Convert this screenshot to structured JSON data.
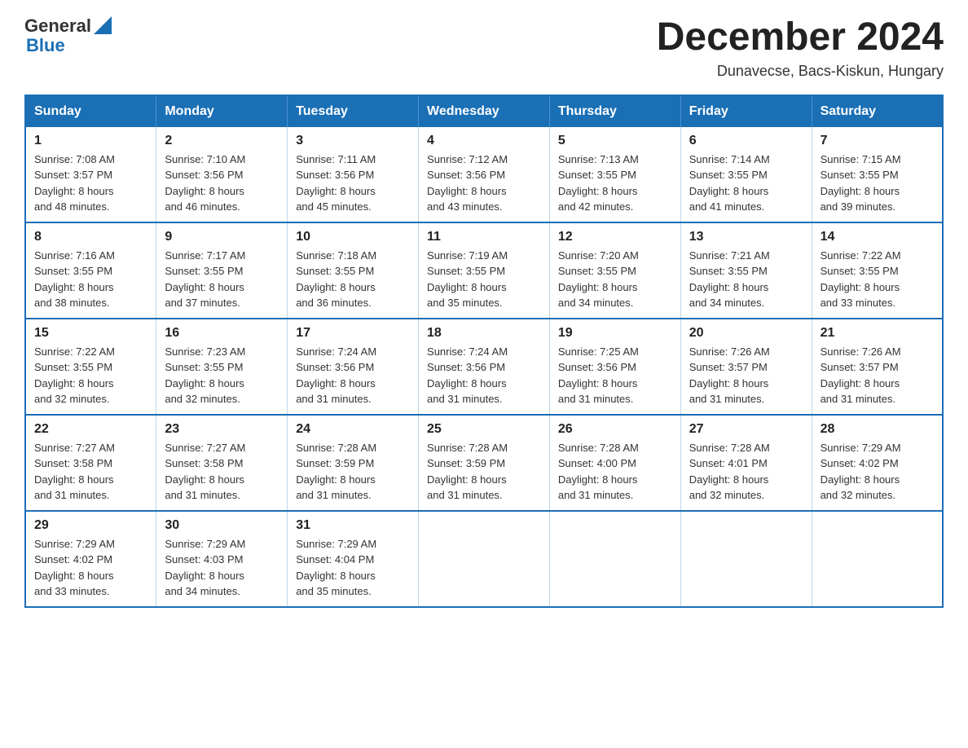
{
  "header": {
    "logo": {
      "text_general": "General",
      "text_blue": "Blue"
    },
    "title": "December 2024",
    "location": "Dunavecse, Bacs-Kiskun, Hungary"
  },
  "weekdays": [
    "Sunday",
    "Monday",
    "Tuesday",
    "Wednesday",
    "Thursday",
    "Friday",
    "Saturday"
  ],
  "weeks": [
    [
      {
        "day": "1",
        "sunrise": "7:08 AM",
        "sunset": "3:57 PM",
        "daylight": "8 hours and 48 minutes."
      },
      {
        "day": "2",
        "sunrise": "7:10 AM",
        "sunset": "3:56 PM",
        "daylight": "8 hours and 46 minutes."
      },
      {
        "day": "3",
        "sunrise": "7:11 AM",
        "sunset": "3:56 PM",
        "daylight": "8 hours and 45 minutes."
      },
      {
        "day": "4",
        "sunrise": "7:12 AM",
        "sunset": "3:56 PM",
        "daylight": "8 hours and 43 minutes."
      },
      {
        "day": "5",
        "sunrise": "7:13 AM",
        "sunset": "3:55 PM",
        "daylight": "8 hours and 42 minutes."
      },
      {
        "day": "6",
        "sunrise": "7:14 AM",
        "sunset": "3:55 PM",
        "daylight": "8 hours and 41 minutes."
      },
      {
        "day": "7",
        "sunrise": "7:15 AM",
        "sunset": "3:55 PM",
        "daylight": "8 hours and 39 minutes."
      }
    ],
    [
      {
        "day": "8",
        "sunrise": "7:16 AM",
        "sunset": "3:55 PM",
        "daylight": "8 hours and 38 minutes."
      },
      {
        "day": "9",
        "sunrise": "7:17 AM",
        "sunset": "3:55 PM",
        "daylight": "8 hours and 37 minutes."
      },
      {
        "day": "10",
        "sunrise": "7:18 AM",
        "sunset": "3:55 PM",
        "daylight": "8 hours and 36 minutes."
      },
      {
        "day": "11",
        "sunrise": "7:19 AM",
        "sunset": "3:55 PM",
        "daylight": "8 hours and 35 minutes."
      },
      {
        "day": "12",
        "sunrise": "7:20 AM",
        "sunset": "3:55 PM",
        "daylight": "8 hours and 34 minutes."
      },
      {
        "day": "13",
        "sunrise": "7:21 AM",
        "sunset": "3:55 PM",
        "daylight": "8 hours and 34 minutes."
      },
      {
        "day": "14",
        "sunrise": "7:22 AM",
        "sunset": "3:55 PM",
        "daylight": "8 hours and 33 minutes."
      }
    ],
    [
      {
        "day": "15",
        "sunrise": "7:22 AM",
        "sunset": "3:55 PM",
        "daylight": "8 hours and 32 minutes."
      },
      {
        "day": "16",
        "sunrise": "7:23 AM",
        "sunset": "3:55 PM",
        "daylight": "8 hours and 32 minutes."
      },
      {
        "day": "17",
        "sunrise": "7:24 AM",
        "sunset": "3:56 PM",
        "daylight": "8 hours and 31 minutes."
      },
      {
        "day": "18",
        "sunrise": "7:24 AM",
        "sunset": "3:56 PM",
        "daylight": "8 hours and 31 minutes."
      },
      {
        "day": "19",
        "sunrise": "7:25 AM",
        "sunset": "3:56 PM",
        "daylight": "8 hours and 31 minutes."
      },
      {
        "day": "20",
        "sunrise": "7:26 AM",
        "sunset": "3:57 PM",
        "daylight": "8 hours and 31 minutes."
      },
      {
        "day": "21",
        "sunrise": "7:26 AM",
        "sunset": "3:57 PM",
        "daylight": "8 hours and 31 minutes."
      }
    ],
    [
      {
        "day": "22",
        "sunrise": "7:27 AM",
        "sunset": "3:58 PM",
        "daylight": "8 hours and 31 minutes."
      },
      {
        "day": "23",
        "sunrise": "7:27 AM",
        "sunset": "3:58 PM",
        "daylight": "8 hours and 31 minutes."
      },
      {
        "day": "24",
        "sunrise": "7:28 AM",
        "sunset": "3:59 PM",
        "daylight": "8 hours and 31 minutes."
      },
      {
        "day": "25",
        "sunrise": "7:28 AM",
        "sunset": "3:59 PM",
        "daylight": "8 hours and 31 minutes."
      },
      {
        "day": "26",
        "sunrise": "7:28 AM",
        "sunset": "4:00 PM",
        "daylight": "8 hours and 31 minutes."
      },
      {
        "day": "27",
        "sunrise": "7:28 AM",
        "sunset": "4:01 PM",
        "daylight": "8 hours and 32 minutes."
      },
      {
        "day": "28",
        "sunrise": "7:29 AM",
        "sunset": "4:02 PM",
        "daylight": "8 hours and 32 minutes."
      }
    ],
    [
      {
        "day": "29",
        "sunrise": "7:29 AM",
        "sunset": "4:02 PM",
        "daylight": "8 hours and 33 minutes."
      },
      {
        "day": "30",
        "sunrise": "7:29 AM",
        "sunset": "4:03 PM",
        "daylight": "8 hours and 34 minutes."
      },
      {
        "day": "31",
        "sunrise": "7:29 AM",
        "sunset": "4:04 PM",
        "daylight": "8 hours and 35 minutes."
      },
      null,
      null,
      null,
      null
    ]
  ],
  "labels": {
    "sunrise": "Sunrise:",
    "sunset": "Sunset:",
    "daylight": "Daylight:"
  }
}
